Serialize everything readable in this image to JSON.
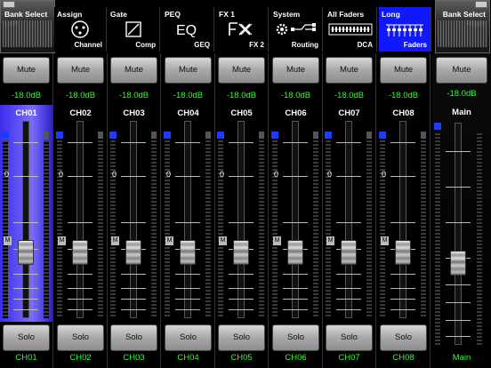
{
  "top_bar": {
    "bank_left": "Bank Select\nLeft",
    "bank_right": "Bank Select\nRight",
    "tabs": [
      {
        "top": "Assign",
        "bottom": "Channel",
        "icon": "xlr-icon"
      },
      {
        "top": "Gate",
        "bottom": "Comp",
        "icon": "gate-comp-icon"
      },
      {
        "top": "PEQ",
        "bottom": "GEQ",
        "icon": "eq-icon"
      },
      {
        "top": "FX 1",
        "bottom": "FX 2",
        "icon": "fx-icon"
      },
      {
        "top": "System",
        "bottom": "Routing",
        "icon": "gear-routing-icon"
      },
      {
        "top": "All Faders",
        "bottom": "DCA",
        "icon": "faders-grid-icon"
      },
      {
        "top": "Long",
        "bottom": "Faders",
        "icon": "long-faders-icon",
        "active": true
      }
    ]
  },
  "channels": [
    {
      "name": "CH01",
      "bottom": "CH01",
      "mute": "Mute",
      "solo": "Solo",
      "db": "-18.0dB",
      "selected": true
    },
    {
      "name": "CH02",
      "bottom": "CH02",
      "mute": "Mute",
      "solo": "Solo",
      "db": "-18.0dB"
    },
    {
      "name": "CH03",
      "bottom": "CH03",
      "mute": "Mute",
      "solo": "Solo",
      "db": "-18.0dB"
    },
    {
      "name": "CH04",
      "bottom": "CH04",
      "mute": "Mute",
      "solo": "Solo",
      "db": "-18.0dB"
    },
    {
      "name": "CH05",
      "bottom": "CH05",
      "mute": "Mute",
      "solo": "Solo",
      "db": "-18.0dB"
    },
    {
      "name": "CH06",
      "bottom": "CH06",
      "mute": "Mute",
      "solo": "Solo",
      "db": "-18.0dB"
    },
    {
      "name": "CH07",
      "bottom": "CH07",
      "mute": "Mute",
      "solo": "Solo",
      "db": "-18.0dB"
    },
    {
      "name": "CH08",
      "bottom": "CH08",
      "mute": "Mute",
      "solo": "Solo",
      "db": "-18.0dB"
    }
  ],
  "main": {
    "name": "Main",
    "bottom": "Main",
    "mute": "Mute",
    "db": "-18.0dB"
  },
  "fader_scale": {
    "zero_label": "0",
    "marker_label": "M"
  },
  "colors": {
    "accent": "#1018ff",
    "level_text": "#2cff2c",
    "selected_strip": "#5a4cff"
  }
}
